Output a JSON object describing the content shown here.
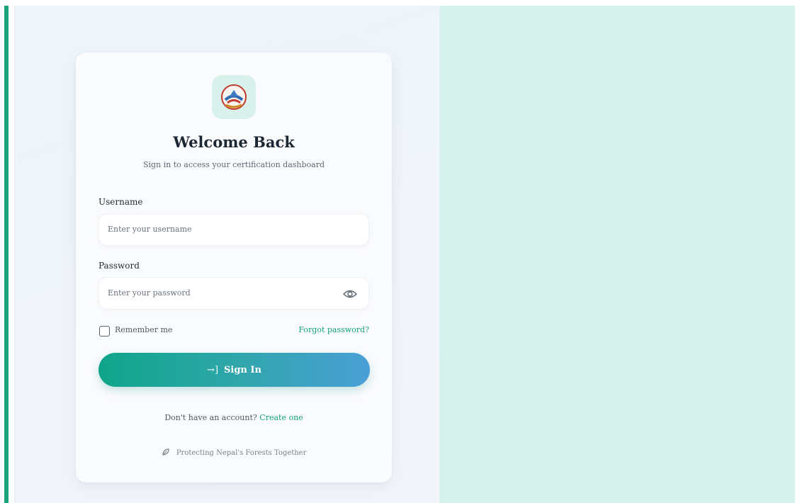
{
  "login": {
    "title": "Welcome Back",
    "subtitle": "Sign in to access your certification dashboard",
    "username_label": "Username",
    "username_placeholder": "Enter your username",
    "password_label": "Password",
    "password_placeholder": "Enter your password",
    "remember_label": "Remember me",
    "forgot_label": "Forgot password?",
    "signin_icon": "→]",
    "signin_label": "Sign In",
    "no_account_text": "Don't have an account?",
    "create_link": "Create one",
    "footer_text": "Protecting Nepal's Forests Together"
  },
  "icons": {
    "logo": "nepal-emblem-icon",
    "eye": "eye-icon",
    "signin": "login-arrow-icon",
    "footer": "leaf-icon"
  },
  "colors": {
    "accent": "#1aa37a",
    "right_panel": "#d5f3ec",
    "link": "#12a37c",
    "button_start": "#0fa58a",
    "button_end": "#4a9fd6"
  }
}
